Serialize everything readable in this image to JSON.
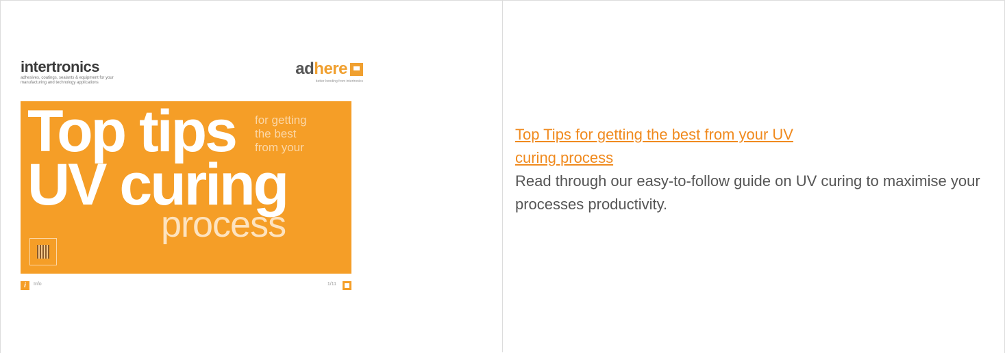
{
  "brochure": {
    "brand_left": "intertronics",
    "brand_left_sub": "adhesives, coatings, sealants & equipment for your manufacturing and technology applications",
    "brand_right_a": "ad",
    "brand_right_b": "here",
    "brand_right_sub": "better bonding from intertronics",
    "headline_line1": "Top tips",
    "headline_line2": "UV curing",
    "headline_line3": "process",
    "side_line1": "for getting",
    "side_line2": "the best",
    "side_line3": "from your",
    "footer_info": "Info",
    "footer_page": "1/11"
  },
  "article": {
    "title": "Top Tips for getting the best from your UV curing process",
    "description": "Read through our easy-to-follow guide on UV curing to maximise your processes productivity."
  },
  "colors": {
    "accent": "#f59e27",
    "link": "#f08a1e",
    "text": "#555555",
    "border": "#dcdcdc"
  }
}
